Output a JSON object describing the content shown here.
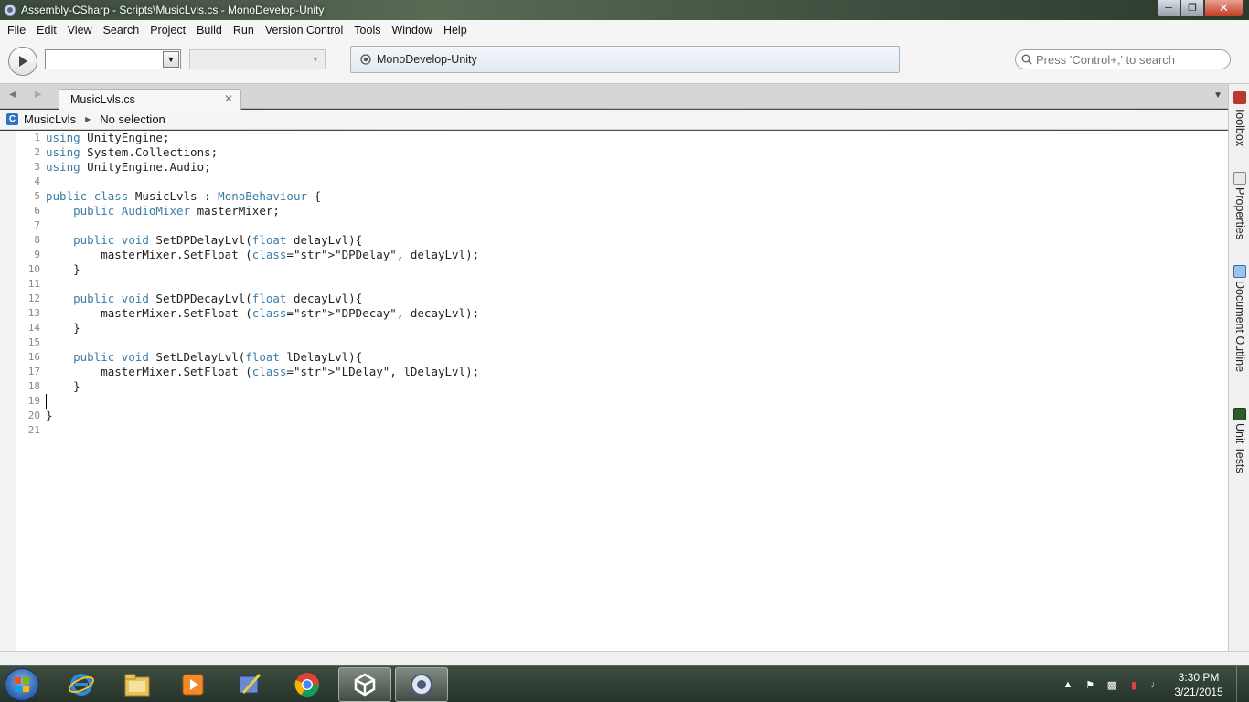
{
  "window": {
    "title": "Assembly-CSharp - Scripts\\MusicLvls.cs - MonoDevelop-Unity"
  },
  "menu": [
    "File",
    "Edit",
    "View",
    "Search",
    "Project",
    "Build",
    "Run",
    "Version Control",
    "Tools",
    "Window",
    "Help"
  ],
  "toolbar": {
    "status_text": "MonoDevelop-Unity",
    "search_placeholder": "Press 'Control+,' to search"
  },
  "tabs": [
    {
      "label": "MusicLvls.cs"
    }
  ],
  "breadcrumb": {
    "class_name": "MusicLvls",
    "selection": "No selection"
  },
  "code_lines": [
    {
      "n": "1",
      "text": "using UnityEngine;"
    },
    {
      "n": "2",
      "text": "using System.Collections;"
    },
    {
      "n": "3",
      "text": "using UnityEngine.Audio;"
    },
    {
      "n": "4",
      "text": ""
    },
    {
      "n": "5",
      "text": "public class MusicLvls : MonoBehaviour {"
    },
    {
      "n": "6",
      "text": "    public AudioMixer masterMixer;"
    },
    {
      "n": "7",
      "text": ""
    },
    {
      "n": "8",
      "text": "    public void SetDPDelayLvl(float delayLvl){"
    },
    {
      "n": "9",
      "text": "        masterMixer.SetFloat (\"DPDelay\", delayLvl);"
    },
    {
      "n": "10",
      "text": "    }"
    },
    {
      "n": "11",
      "text": ""
    },
    {
      "n": "12",
      "text": "    public void SetDPDecayLvl(float decayLvl){"
    },
    {
      "n": "13",
      "text": "        masterMixer.SetFloat (\"DPDecay\", decayLvl);"
    },
    {
      "n": "14",
      "text": "    }"
    },
    {
      "n": "15",
      "text": ""
    },
    {
      "n": "16",
      "text": "    public void SetLDelayLvl(float lDelayLvl){"
    },
    {
      "n": "17",
      "text": "        masterMixer.SetFloat (\"LDelay\", lDelayLvl);"
    },
    {
      "n": "18",
      "text": "    }"
    },
    {
      "n": "19",
      "text": ""
    },
    {
      "n": "20",
      "text": "}"
    },
    {
      "n": "21",
      "text": ""
    }
  ],
  "dock": [
    "Toolbox",
    "Properties",
    "Document Outline",
    "Unit Tests"
  ],
  "taskbar": {
    "time": "3:30 PM",
    "date": "3/21/2015"
  },
  "colors": {
    "keyword": "#3a7da8",
    "string": "#d6862a",
    "accent": "#2f74c0"
  }
}
